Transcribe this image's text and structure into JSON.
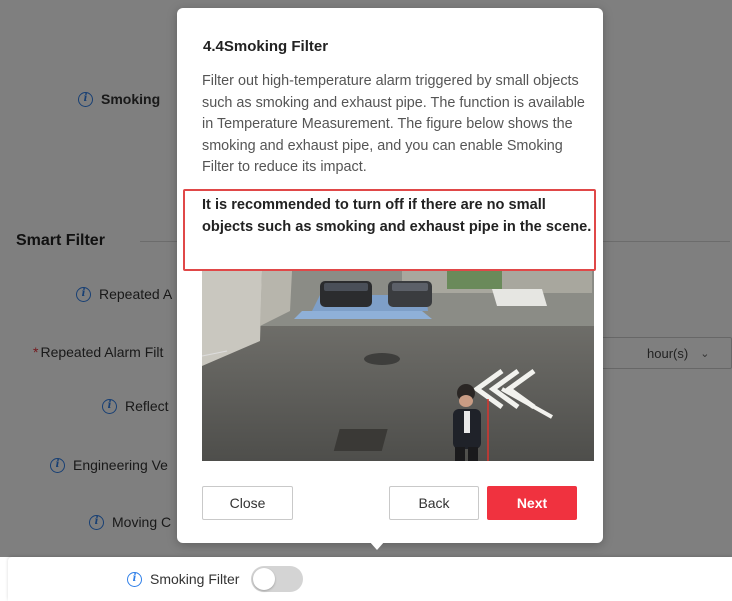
{
  "background": {
    "smoking_label": "Smoking",
    "section_title": "Smart Filter",
    "rows": [
      {
        "label": "Repeated A"
      },
      {
        "label": "Repeated Alarm Filt"
      },
      {
        "label": "Reflect"
      },
      {
        "label": "Engineering Ve"
      },
      {
        "label": "Moving C"
      }
    ],
    "unit_select": "hour(s)"
  },
  "bottom_strip": {
    "label": "Smoking Filter",
    "toggle_on": false
  },
  "popup": {
    "title": "4.4Smoking Filter",
    "description": "Filter out high-temperature alarm triggered by small objects such as smoking and exhaust pipe. The function is available in Temperature Measurement. The figure below shows the smoking and exhaust pipe, and you can enable Smoking Filter to reduce its impact.",
    "note": "It is recommended to turn off if there are no small objects such as smoking and exhaust pipe in the scene.",
    "buttons": {
      "close": "Close",
      "back": "Back",
      "next": "Next"
    }
  },
  "colors": {
    "accent_red": "#f0323f",
    "highlight_border": "#e04848",
    "info_blue": "#2f7fe8"
  }
}
